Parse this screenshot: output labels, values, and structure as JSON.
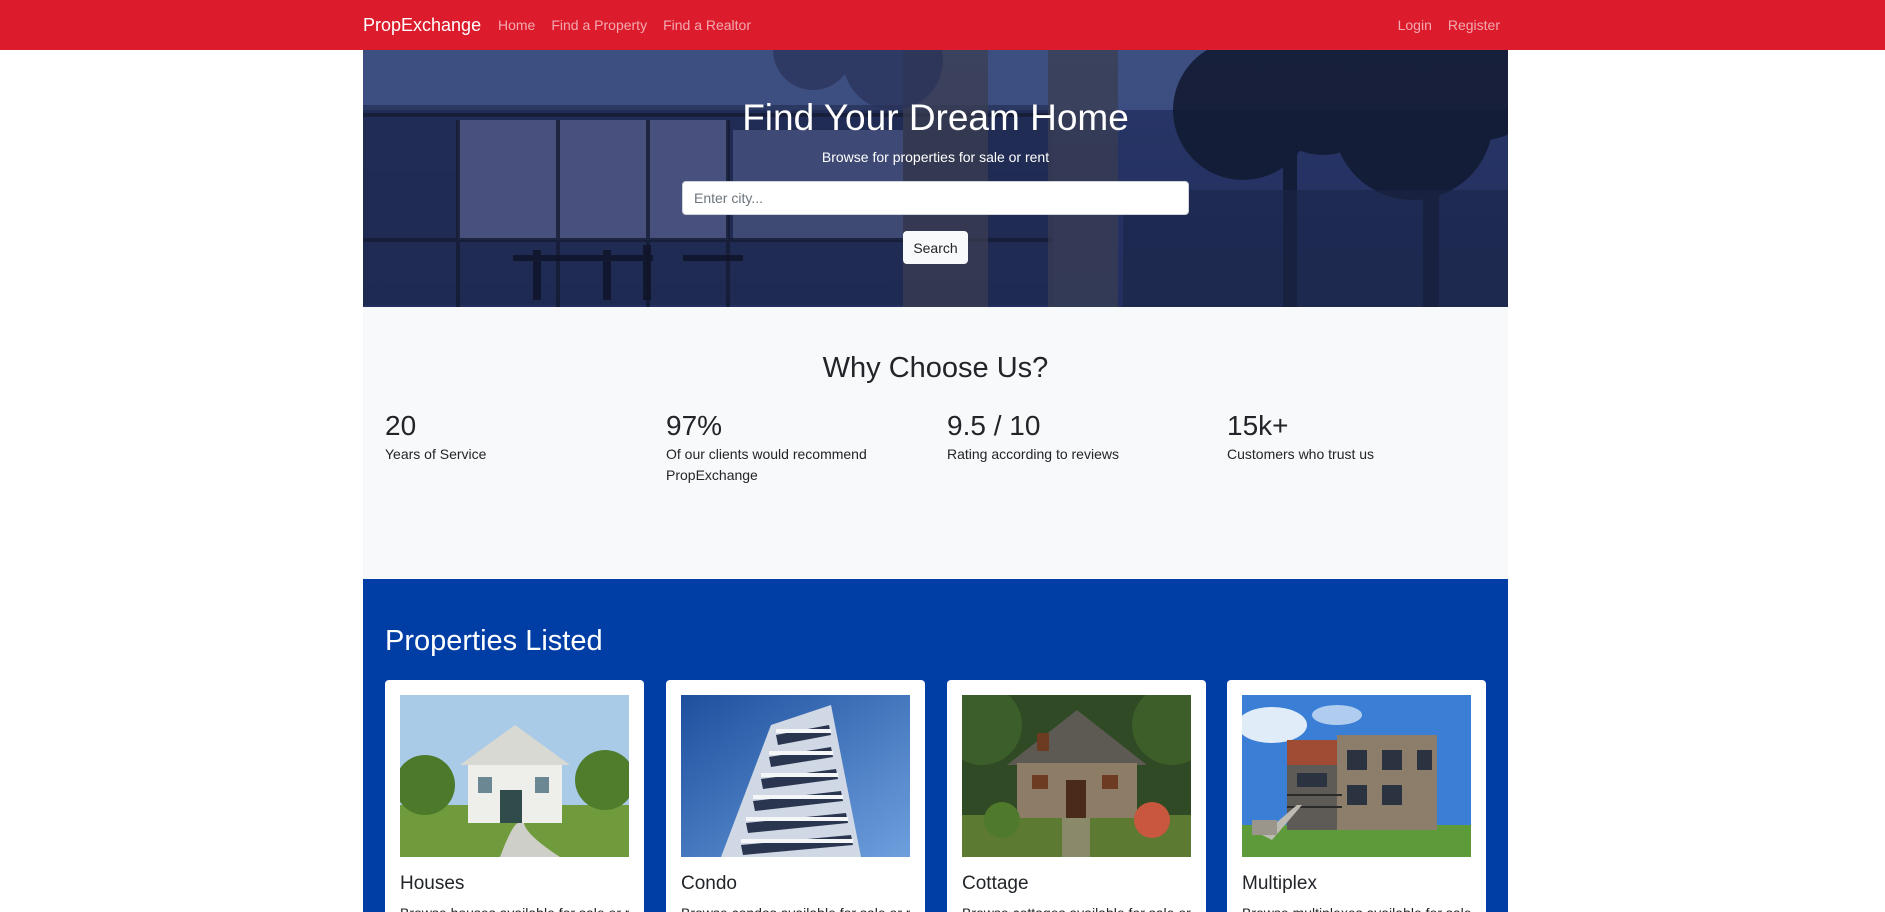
{
  "navbar": {
    "brand": "PropExchange",
    "links_left": [
      "Home",
      "Find a Property",
      "Find a Realtor"
    ],
    "links_right": [
      "Login",
      "Register"
    ],
    "background": "#dc1b2c"
  },
  "hero": {
    "title": "Find Your Dream Home",
    "subtitle": "Browse for properties for sale or rent",
    "search_placeholder": "Enter city...",
    "search_button": "Search"
  },
  "why": {
    "title": "Why Choose Us?",
    "stats": [
      {
        "value": "20",
        "label": "Years of Service"
      },
      {
        "value": "97%",
        "label": "Of our clients would recommend PropExchange"
      },
      {
        "value": "9.5 / 10",
        "label": "Rating according to reviews"
      },
      {
        "value": "15k+",
        "label": "Customers who trust us"
      }
    ]
  },
  "properties": {
    "title": "Properties Listed",
    "background": "#003da5",
    "cards": [
      {
        "title": "Houses",
        "text": "Browse houses available for sale or rent"
      },
      {
        "title": "Condo",
        "text": "Browse condos available for sale or rent"
      },
      {
        "title": "Cottage",
        "text": "Browse cottages available for sale or rent"
      },
      {
        "title": "Multiplex",
        "text": "Browse multiplexes available for sale or rent"
      }
    ]
  }
}
